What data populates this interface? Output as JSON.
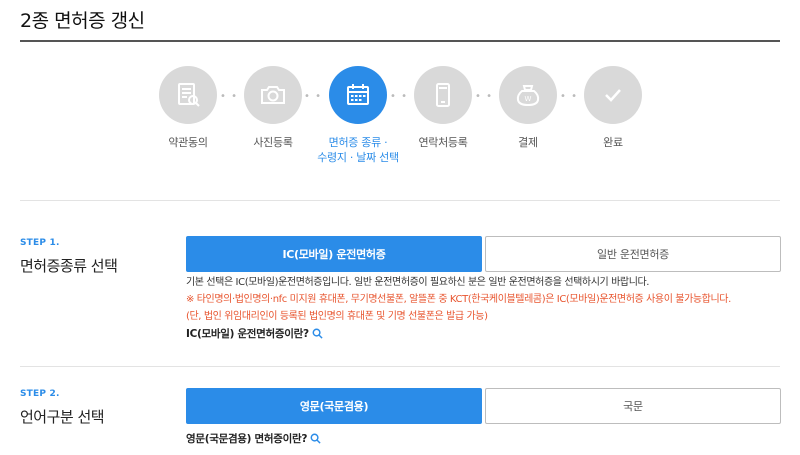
{
  "page": {
    "title": "2종 면허증 갱신"
  },
  "progress": {
    "steps": [
      {
        "label": "약관동의",
        "icon": "document-search-icon"
      },
      {
        "label": "사진등록",
        "icon": "camera-icon"
      },
      {
        "label": "면허증 종류 ·",
        "label2": "수령지 · 날짜 선택",
        "icon": "calendar-icon",
        "active": true
      },
      {
        "label": "연락처등록",
        "icon": "phone-icon"
      },
      {
        "label": "결제",
        "icon": "payment-bag-icon"
      },
      {
        "label": "완료",
        "icon": "check-icon"
      }
    ],
    "colors": {
      "active": "#2b8ce8",
      "inactive": "#d9d9d9"
    }
  },
  "step1": {
    "tag": "STEP 1.",
    "title": "면허증종류 선택",
    "option_ic": "IC(모바일) 운전면허증",
    "option_general": "일반 운전면허증",
    "note_line1": "기본 선택은 IC(모바일)운전면허증입니다. 일반 운전면허증이 필요하신 분은 일반 운전면허증을 선택하시기 바랍니다.",
    "note_line2": "※ 타인명의·법인명의·nfc 미지원 휴대폰, 무기명선불폰, 알뜰폰 중 KCT(한국케이블텔레콤)은 IC(모바일)운전면허증 사용이 불가능합니다.",
    "note_line3": "(단, 법인 위임대리인이 등록된 법인명의 휴대폰 및 기명 선불폰은 발급 가능)",
    "info_link": "IC(모바일) 운전면허증이란?"
  },
  "step2": {
    "tag": "STEP 2.",
    "title": "언어구분 선택",
    "option_en": "영문(국문겸용)",
    "option_ko": "국문",
    "info_link": "영문(국문겸용) 면허증이란?"
  }
}
